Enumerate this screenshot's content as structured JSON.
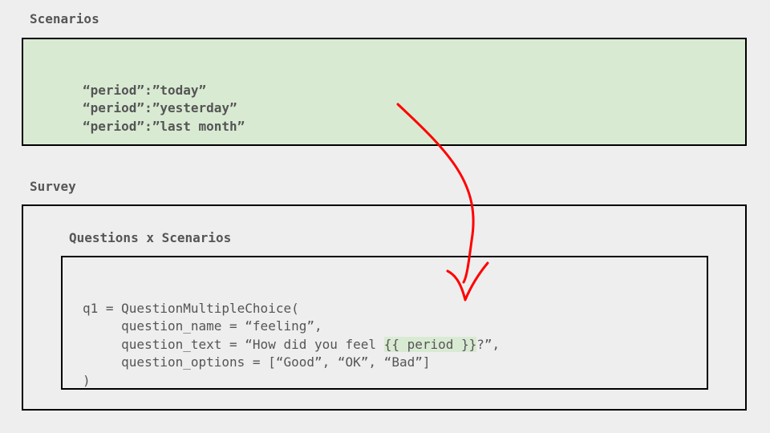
{
  "scenarios": {
    "title": "Scenarios",
    "lines": [
      "“period”:”today”",
      "“period”:”yesterday”",
      "“period”:”last month”"
    ],
    "fill": "#d9ead3"
  },
  "survey": {
    "title": "Survey",
    "subtitle": "Questions x Scenarios",
    "code": {
      "line1": "q1 = QuestionMultipleChoice(",
      "line2": "     question_name = “feeling”,",
      "line3_pre": "     question_text = “How did you feel ",
      "line3_hl": "{{ period }}",
      "line3_post": "?”,",
      "line4": "     question_options = [“Good”, “OK”, “Bad”]",
      "line5": ")"
    }
  },
  "arrow_color": "#ff0000"
}
